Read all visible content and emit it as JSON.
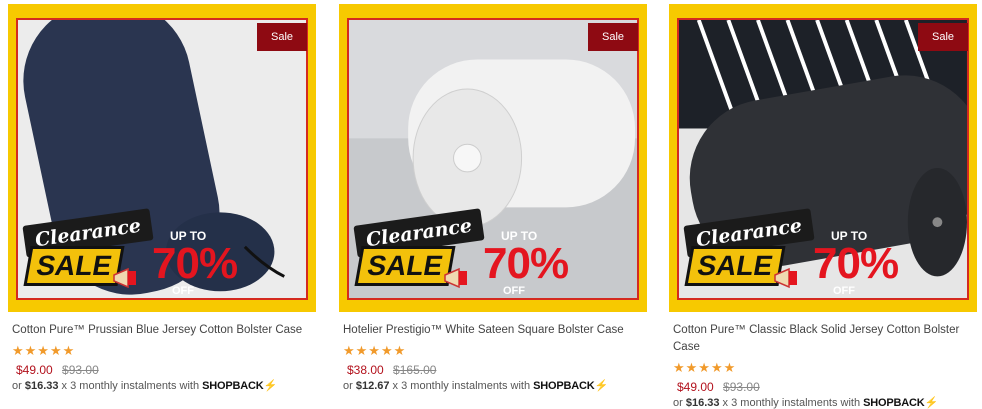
{
  "products": [
    {
      "sale_label": "Sale",
      "promo": {
        "line1": "Clearance",
        "line2": "SALE",
        "upto": "UP TO",
        "percent": "70%",
        "off": "OFF"
      },
      "title": "Cotton Pure™ Prussian Blue Jersey Cotton Bolster Case",
      "stars": "★★★★★",
      "price": "$49.00",
      "old_price": "$93.00",
      "install_prefix": "or ",
      "install_amount": "$16.33",
      "install_suffix": " x 3 monthly instalments with ",
      "shopback": "SHOPBACK",
      "bolt": "⚡",
      "colors": {
        "bolster": "#2a3550"
      }
    },
    {
      "sale_label": "Sale",
      "promo": {
        "line1": "Clearance",
        "line2": "SALE",
        "upto": "UP TO",
        "percent": "70%",
        "off": "OFF"
      },
      "title": "Hotelier Prestigio™ White Sateen Square Bolster Case",
      "stars": "★★★★★",
      "price": "$38.00",
      "old_price": "$165.00",
      "install_prefix": "or ",
      "install_amount": "$12.67",
      "install_suffix": " x 3 monthly instalments with ",
      "shopback": "SHOPBACK",
      "bolt": "⚡",
      "colors": {
        "bolster": "#f2f2f2"
      }
    },
    {
      "sale_label": "Sale",
      "promo": {
        "line1": "Clearance",
        "line2": "SALE",
        "upto": "UP TO",
        "percent": "70%",
        "off": "OFF"
      },
      "title": "Cotton Pure™ Classic Black Solid Jersey Cotton Bolster Case",
      "stars": "★★★★★",
      "price": "$49.00",
      "old_price": "$93.00",
      "install_prefix": "or ",
      "install_amount": "$16.33",
      "install_suffix": " x 3 monthly instalments with ",
      "shopback": "SHOPBACK",
      "bolt": "⚡",
      "colors": {
        "bolster": "#2f3136"
      }
    }
  ]
}
